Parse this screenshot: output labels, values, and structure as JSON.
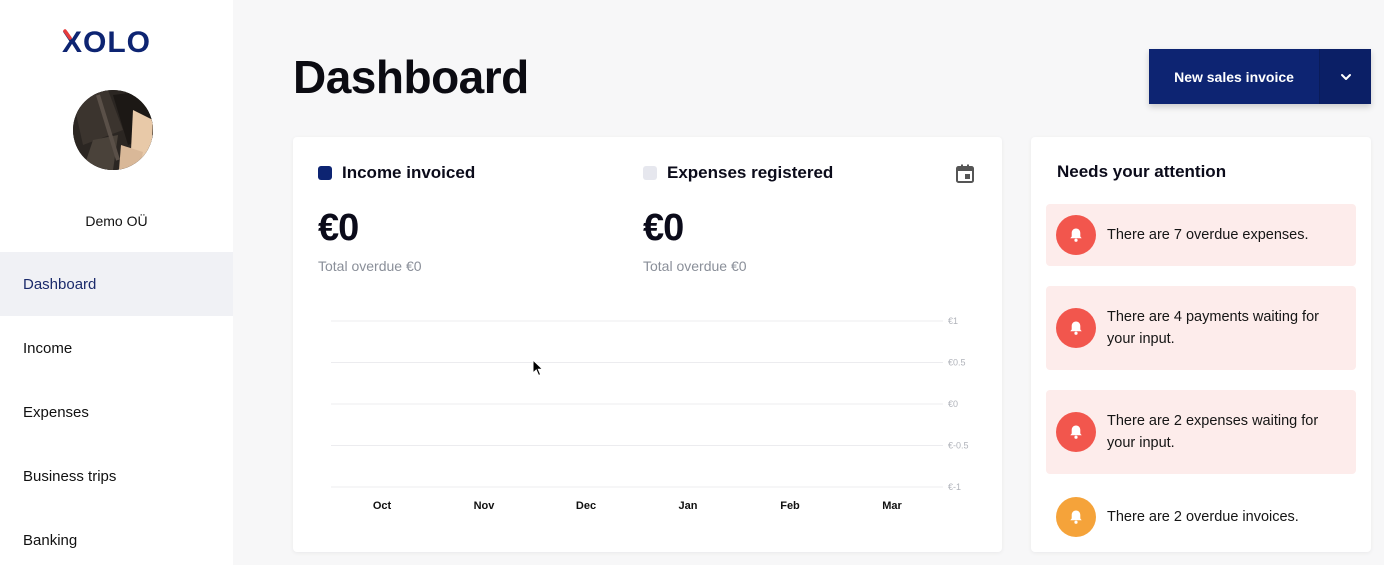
{
  "brand": {
    "logo_text": "XOLO",
    "logo_color": "#0d2472",
    "accent_color": "#e63c3c"
  },
  "sidebar": {
    "company_name": "Demo OÜ",
    "items": [
      {
        "label": "Dashboard",
        "active": true
      },
      {
        "label": "Income",
        "active": false
      },
      {
        "label": "Expenses",
        "active": false
      },
      {
        "label": "Business trips",
        "active": false
      },
      {
        "label": "Banking",
        "active": false
      }
    ]
  },
  "header": {
    "title": "Dashboard",
    "primary_button": "New sales invoice",
    "dropdown_icon": "chevron-down-icon"
  },
  "summary": {
    "income": {
      "label": "Income invoiced",
      "value": "€0",
      "overdue": "Total overdue €0",
      "color": "#0d2472"
    },
    "expenses": {
      "label": "Expenses registered",
      "value": "€0",
      "overdue": "Total overdue €0",
      "color": "#e6e7ee"
    },
    "calendar_icon": "calendar-icon"
  },
  "chart_data": {
    "type": "bar",
    "categories": [
      "Oct",
      "Nov",
      "Dec",
      "Jan",
      "Feb",
      "Mar"
    ],
    "series": [
      {
        "name": "Income invoiced",
        "values": [
          0,
          0,
          0,
          0,
          0,
          0
        ]
      },
      {
        "name": "Expenses registered",
        "values": [
          0,
          0,
          0,
          0,
          0,
          0
        ]
      }
    ],
    "y_ticks": [
      "€1",
      "€0.5",
      "€0",
      "€-0.5",
      "€-1"
    ],
    "ylim": [
      -1,
      1
    ],
    "grid": true,
    "legend": "top-left"
  },
  "attention": {
    "title": "Needs your attention",
    "items": [
      {
        "text": "There are 7 overdue expenses.",
        "level": "red"
      },
      {
        "text": "There are 4 payments waiting for your input.",
        "level": "red"
      },
      {
        "text": "There are 2 expenses waiting for your input.",
        "level": "red"
      },
      {
        "text": "There are 2 overdue invoices.",
        "level": "orange"
      }
    ]
  }
}
